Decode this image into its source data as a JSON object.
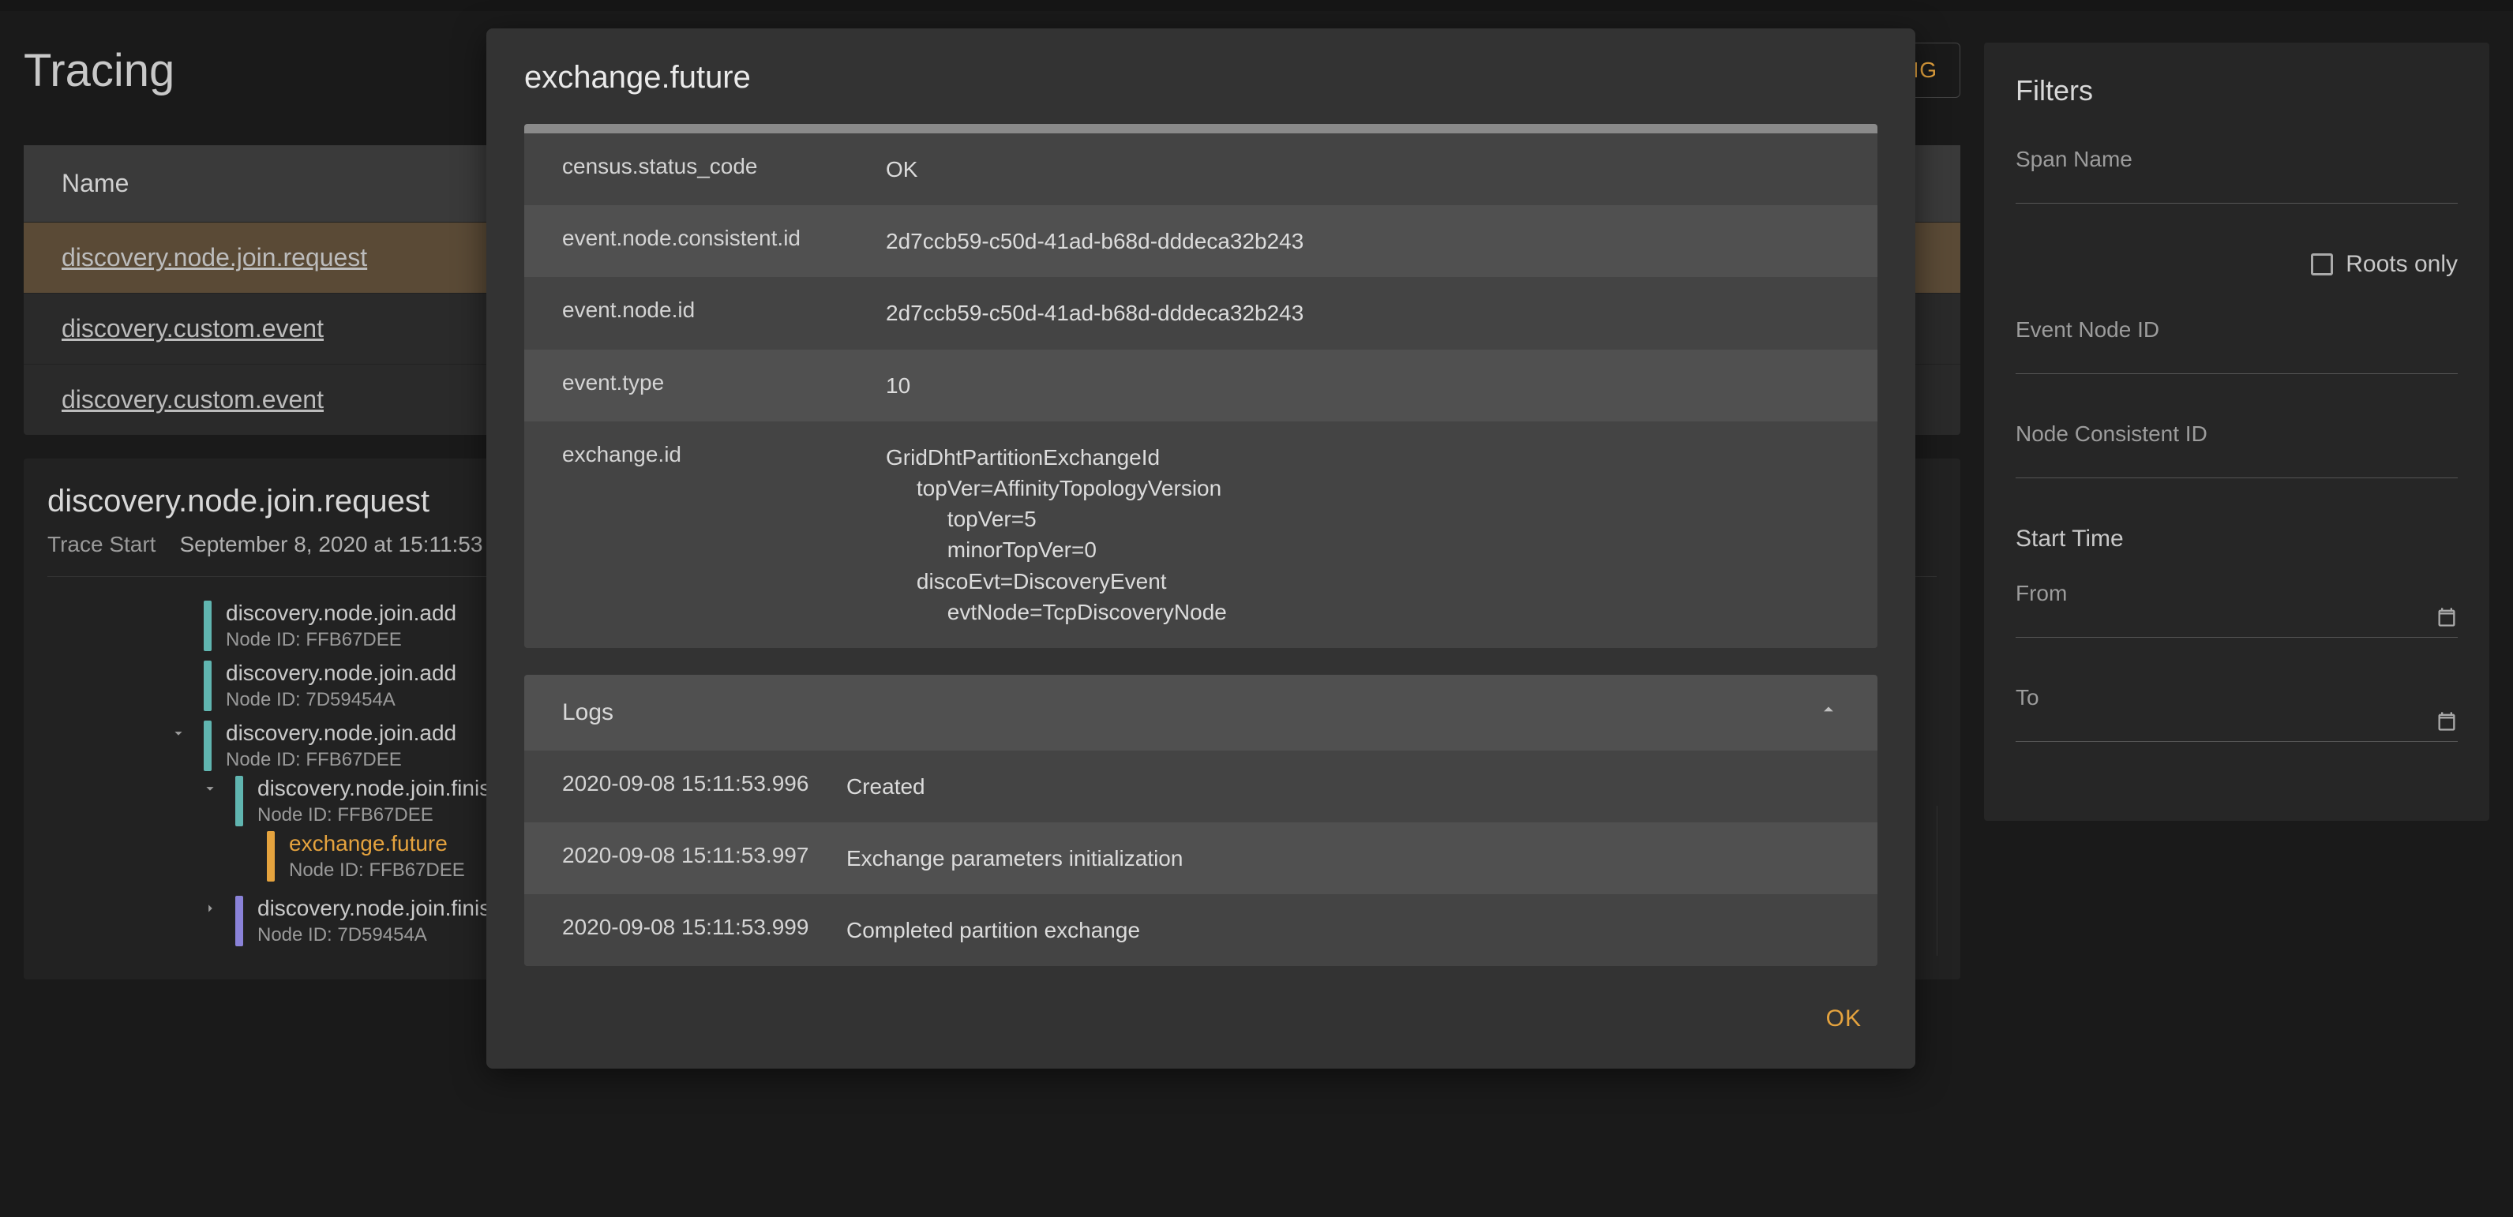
{
  "header": {
    "title": "Tracing",
    "configure_label": "CONFIGURE TRACING"
  },
  "table": {
    "name_header": "Name",
    "rows": [
      {
        "link": "discovery.node.join.request",
        "highlighted": true
      },
      {
        "link": "discovery.custom.event",
        "highlighted": false
      },
      {
        "link": "discovery.custom.event",
        "highlighted": false
      }
    ]
  },
  "trace": {
    "title": "discovery.node.join.request",
    "start_label": "Trace Start",
    "start_value": "September 8, 2020 at 15:11:53",
    "tree": [
      {
        "level": 0,
        "bar": "teal",
        "name": "discovery.node.join.add",
        "node": "Node ID: FFB67DEE",
        "toggle": "none"
      },
      {
        "level": 0,
        "bar": "teal",
        "name": "discovery.node.join.add",
        "node": "Node ID: 7D59454A",
        "toggle": "none"
      },
      {
        "level": 0,
        "bar": "teal",
        "name": "discovery.node.join.add",
        "node": "Node ID: FFB67DEE",
        "toggle": "down"
      },
      {
        "level": 1,
        "bar": "teal",
        "name": "discovery.node.join.finish",
        "node": "Node ID: FFB67DEE",
        "toggle": "down"
      },
      {
        "level": 2,
        "bar": "orange",
        "name": "exchange.future",
        "node": "Node ID: FFB67DEE",
        "toggle": "none",
        "highlight": true
      },
      {
        "level": 1,
        "bar": "purple",
        "name": "discovery.node.join.finish",
        "node": "Node ID: 7D59454A",
        "toggle": "right"
      }
    ]
  },
  "filters": {
    "title": "Filters",
    "span_name_label": "Span Name",
    "roots_only_label": "Roots only",
    "event_node_id_label": "Event Node ID",
    "node_consistent_id_label": "Node Consistent ID",
    "start_time_label": "Start Time",
    "from_label": "From",
    "to_label": "To"
  },
  "modal": {
    "title": "exchange.future",
    "attributes": [
      {
        "k": "census.status_code",
        "v": "OK"
      },
      {
        "k": "event.node.consistent.id",
        "v": "2d7ccb59-c50d-41ad-b68d-dddeca32b243"
      },
      {
        "k": "event.node.id",
        "v": "2d7ccb59-c50d-41ad-b68d-dddeca32b243"
      },
      {
        "k": "event.type",
        "v": "10"
      },
      {
        "k": "exchange.id",
        "v": "GridDhtPartitionExchangeId\n     topVer=AffinityTopologyVersion\n          topVer=5\n          minorTopVer=0\n     discoEvt=DiscoveryEvent\n          evtNode=TcpDiscoveryNode"
      }
    ],
    "logs_label": "Logs",
    "logs": [
      {
        "ts": "2020-09-08 15:11:53.996",
        "msg": "Created"
      },
      {
        "ts": "2020-09-08 15:11:53.997",
        "msg": "Exchange parameters initialization"
      },
      {
        "ts": "2020-09-08 15:11:53.999",
        "msg": "Completed partition exchange"
      }
    ],
    "ok_label": "OK"
  }
}
